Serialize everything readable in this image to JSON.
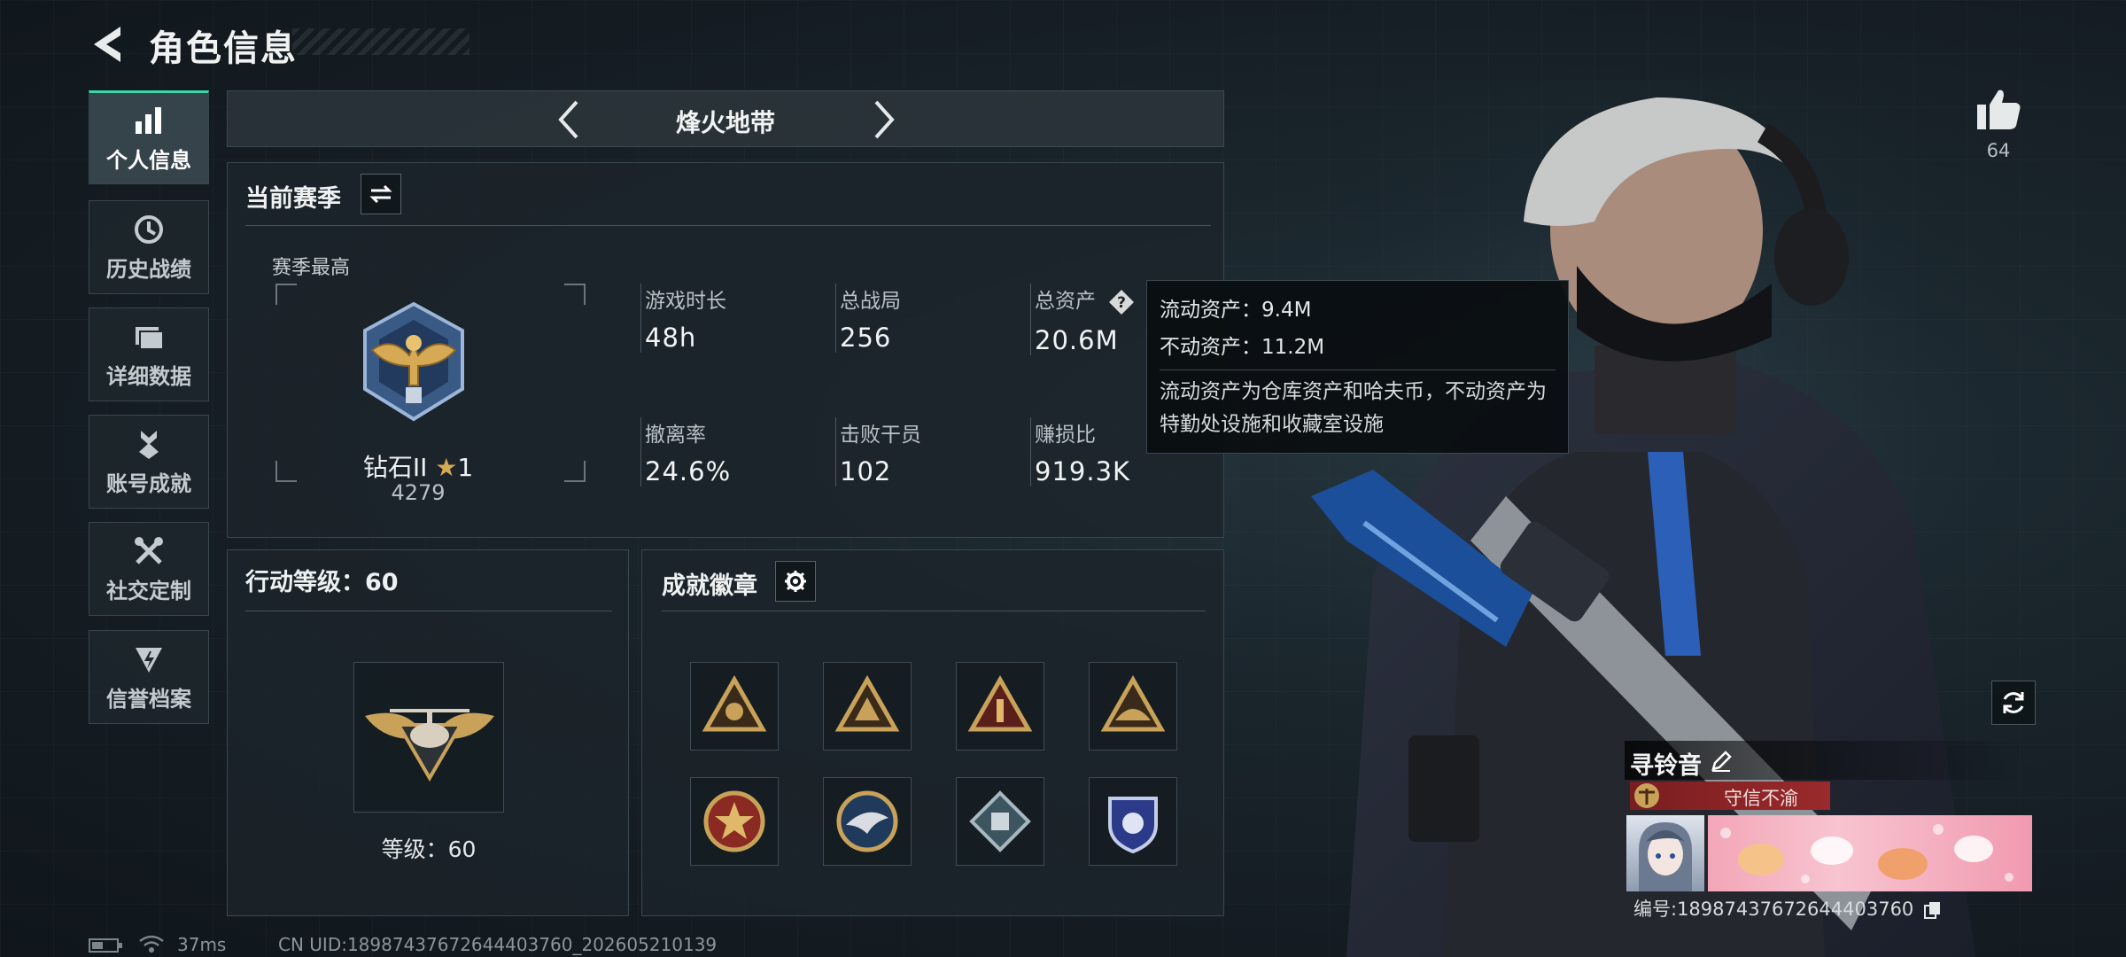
{
  "header": {
    "title": "角色信息"
  },
  "sidebar": {
    "items": [
      {
        "label": "个人信息",
        "icon": "bar-chart-icon",
        "active": true
      },
      {
        "label": "历史战绩",
        "icon": "history-clock-icon",
        "active": false
      },
      {
        "label": "详细数据",
        "icon": "folder-icon",
        "active": false
      },
      {
        "label": "账号成就",
        "icon": "medal-icon",
        "active": false
      },
      {
        "label": "社交定制",
        "icon": "tools-icon",
        "active": false
      },
      {
        "label": "信誉档案",
        "icon": "shield-bolt-icon",
        "active": false
      }
    ]
  },
  "mode_bar": {
    "title": "烽火地带"
  },
  "season": {
    "title": "当前赛季",
    "best_label": "赛季最高",
    "rank_name": "钻石II",
    "rank_stars": "1",
    "rank_score": "4279",
    "stats": [
      {
        "label": "游戏时长",
        "value": "48h"
      },
      {
        "label": "总战局",
        "value": "256"
      },
      {
        "label": "总资产",
        "value": "20.6M"
      },
      {
        "label": "撤离率",
        "value": "24.6%"
      },
      {
        "label": "击败干员",
        "value": "102"
      },
      {
        "label": "赚损比",
        "value": "919.3K"
      }
    ]
  },
  "tooltip": {
    "liquid": "流动资产：9.4M",
    "fixed": "不动资产：11.2M",
    "description": "流动资产为仓库资产和哈夫币，不动资产为特勤处设施和收藏室设施"
  },
  "action_level": {
    "title": "行动等级：60",
    "level_text": "等级：60"
  },
  "achievements": {
    "title": "成就徽章"
  },
  "likes": {
    "count": "64"
  },
  "profile": {
    "name": "寻铃音",
    "title_badge": "守信不渝",
    "id_text": "编号:18987437672644403760"
  },
  "status_bar": {
    "ping": "37ms",
    "uid": "CN UID:18987437672644403760_202605210139"
  },
  "colors": {
    "accent": "#39d6a6",
    "gold": "#c9a25a",
    "title_badge_bg": "#7a1d20"
  }
}
